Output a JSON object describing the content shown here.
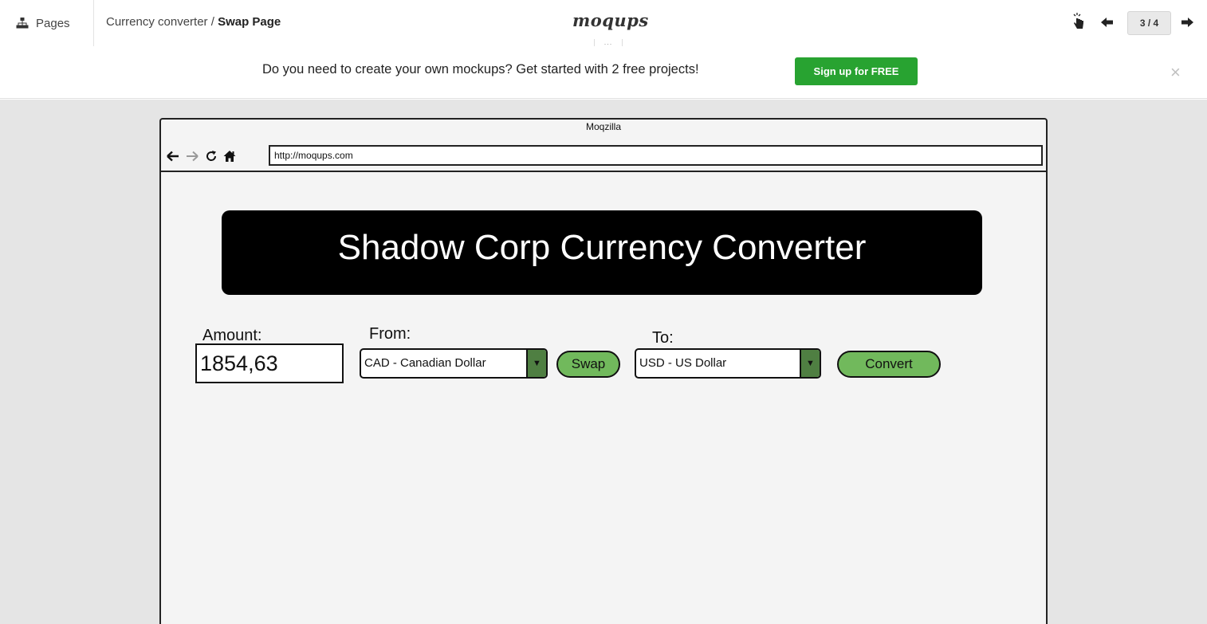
{
  "toolbar": {
    "pages_label": "Pages",
    "breadcrumb_project": "Currency converter",
    "breadcrumb_separator": " / ",
    "breadcrumb_page": "Swap Page",
    "logo": "moqups",
    "dots": "...",
    "page_counter": "3 / 4",
    "icons": [
      "sitemap-icon",
      "hand-pointer-icon",
      "arrow-left-icon",
      "arrow-right-icon"
    ]
  },
  "promo": {
    "text": "Do you need to create your own mockups? Get started with 2 free projects!",
    "signup_label": "Sign up for FREE",
    "close": "×",
    "signup_color": "#28a331"
  },
  "browser": {
    "title": "Moqzilla",
    "url": "http://moqups.com",
    "nav_icons": [
      "back-icon",
      "forward-icon",
      "reload-icon",
      "home-icon"
    ]
  },
  "app": {
    "banner_title": "Shadow Corp Currency Converter",
    "amount_label": "Amount:",
    "amount_value": "1854,63",
    "from_label": "From:",
    "from_value": "CAD - Canadian Dollar",
    "swap_label": "Swap",
    "to_label": "To:",
    "to_value": "USD - US Dollar",
    "convert_label": "Convert",
    "accent_green": "#71b95c",
    "caret_green": "#4f7f42"
  }
}
